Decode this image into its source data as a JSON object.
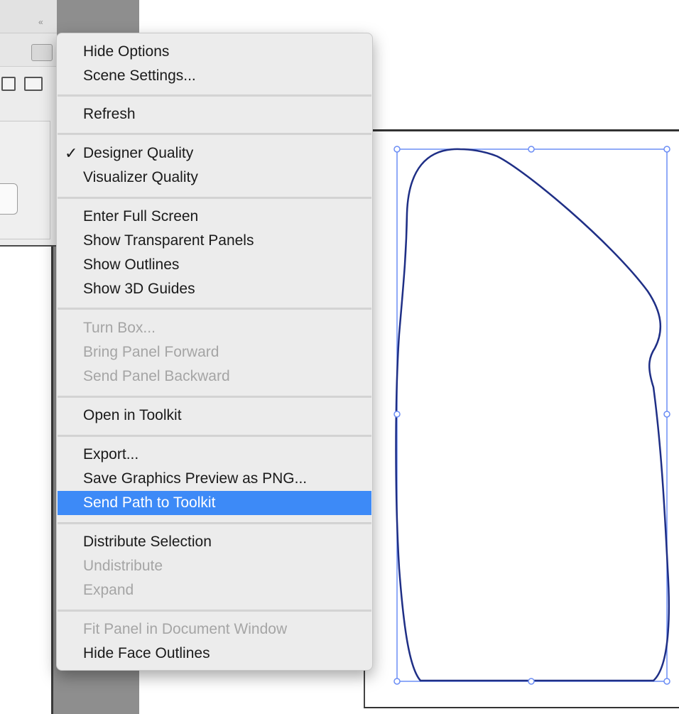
{
  "panel": {
    "collapse_icon": "«"
  },
  "menu": {
    "items": [
      {
        "label": "Hide Options",
        "disabled": false
      },
      {
        "label": "Scene Settings...",
        "disabled": false
      },
      {
        "label": "Refresh",
        "disabled": false
      },
      {
        "label": "Designer Quality",
        "disabled": false,
        "checked": true
      },
      {
        "label": "Visualizer Quality",
        "disabled": false
      },
      {
        "label": "Enter Full Screen",
        "disabled": false
      },
      {
        "label": "Show Transparent Panels",
        "disabled": false
      },
      {
        "label": "Show Outlines",
        "disabled": false
      },
      {
        "label": "Show 3D Guides",
        "disabled": false
      },
      {
        "label": "Turn Box...",
        "disabled": true
      },
      {
        "label": "Bring Panel Forward",
        "disabled": true
      },
      {
        "label": "Send Panel Backward",
        "disabled": true
      },
      {
        "label": "Open in Toolkit",
        "disabled": false
      },
      {
        "label": "Export...",
        "disabled": false
      },
      {
        "label": "Save Graphics Preview as PNG...",
        "disabled": false
      },
      {
        "label": "Send Path to Toolkit",
        "disabled": false,
        "highlighted": true
      },
      {
        "label": "Distribute Selection",
        "disabled": false
      },
      {
        "label": "Undistribute",
        "disabled": true
      },
      {
        "label": "Expand",
        "disabled": true
      },
      {
        "label": "Fit Panel in Document Window",
        "disabled": true
      },
      {
        "label": "Hide Face Outlines",
        "disabled": false
      }
    ],
    "check_glyph": "✓"
  },
  "colors": {
    "highlight": "#3d8af7",
    "path_stroke": "#1f2f86",
    "selection_box": "#6b8df5"
  }
}
